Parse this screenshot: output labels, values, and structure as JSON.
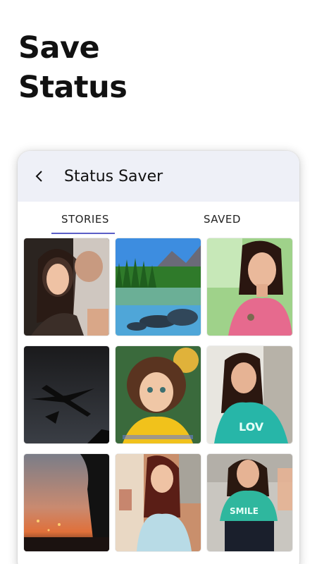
{
  "promo": {
    "line1": "Save",
    "line2": "Status"
  },
  "appbar": {
    "back_icon": "arrow-left-icon",
    "title": "Status Saver",
    "background": "#eef0f7"
  },
  "tabs": [
    {
      "label": "STORIES",
      "active": true
    },
    {
      "label": "SAVED",
      "active": false
    }
  ],
  "accent_color": "#5b5fc7",
  "thumbnails": [
    {
      "subject": "couple photo"
    },
    {
      "subject": "lake with forest and mountains"
    },
    {
      "subject": "girl in pink top"
    },
    {
      "subject": "airplane silhouette at dusk"
    },
    {
      "subject": "curly-haired child"
    },
    {
      "subject": "girl in green LOVE shirt"
    },
    {
      "subject": "sunset silhouette"
    },
    {
      "subject": "woman in blue dress"
    },
    {
      "subject": "girl in green SMILE shirt"
    }
  ]
}
